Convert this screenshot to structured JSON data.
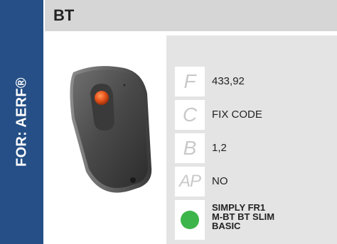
{
  "brand_label": "FOR: AERF®",
  "title": "BT",
  "specs": [
    {
      "letter": "F",
      "value": "433,92"
    },
    {
      "letter": "C",
      "value": "FIX CODE"
    },
    {
      "letter": "B",
      "value": "1,2"
    },
    {
      "letter": "AP",
      "value": "NO"
    }
  ],
  "compatible": {
    "indicator_color": "#3cb54a",
    "lines": [
      "SIMPLY FR1",
      "M-BT BT SLIM",
      "BASIC"
    ]
  },
  "colors": {
    "side_band": "#254f86",
    "header_bg": "#d6d6d6",
    "panel_bg": "#e4e4e4"
  }
}
